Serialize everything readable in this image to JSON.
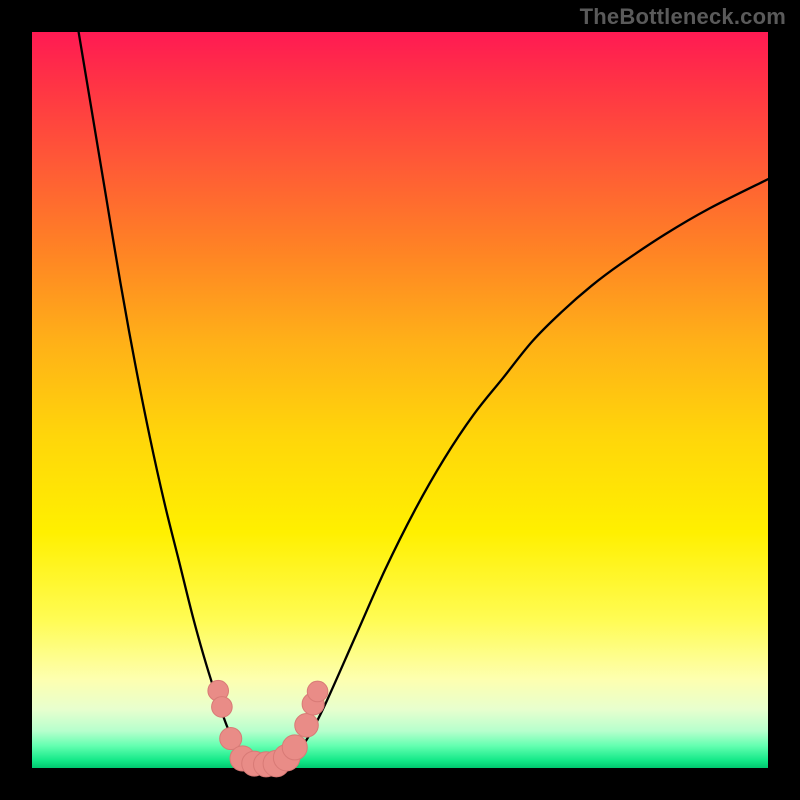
{
  "watermark": {
    "text": "TheBottleneck.com"
  },
  "colors": {
    "frame": "#000000",
    "curve": "#000000",
    "marker_fill": "#e98c87",
    "marker_stroke": "#d87a76",
    "gradient_top": "#ff1a53",
    "gradient_bottom": "#00c86f"
  },
  "chart_data": {
    "type": "line",
    "title": "",
    "xlabel": "",
    "ylabel": "",
    "xlim": [
      0,
      100
    ],
    "ylim": [
      0,
      100
    ],
    "grid": false,
    "legend": false,
    "series": [
      {
        "name": "left-branch",
        "x": [
          6,
          8,
          10,
          12,
          14,
          16,
          18,
          20,
          22,
          24,
          26,
          27,
          28,
          29,
          30
        ],
        "y": [
          102,
          90,
          78,
          66,
          55,
          45,
          36,
          28,
          20,
          13,
          7,
          4.5,
          2.5,
          1.2,
          0.5
        ]
      },
      {
        "name": "right-branch",
        "x": [
          34,
          36,
          38,
          40,
          44,
          48,
          52,
          56,
          60,
          64,
          68,
          72,
          76,
          80,
          86,
          92,
          100
        ],
        "y": [
          0.5,
          2,
          5,
          9,
          18,
          27,
          35,
          42,
          48,
          53,
          58,
          62,
          65.5,
          68.5,
          72.5,
          76,
          80
        ]
      }
    ],
    "flat_bottom": {
      "x_start": 30,
      "x_end": 34,
      "y": 0.3
    },
    "markers": {
      "name": "highlighted-points",
      "points": [
        {
          "x": 25.3,
          "y": 10.5,
          "r": 1.4
        },
        {
          "x": 25.8,
          "y": 8.3,
          "r": 1.4
        },
        {
          "x": 27.0,
          "y": 4.0,
          "r": 1.5
        },
        {
          "x": 28.6,
          "y": 1.3,
          "r": 1.7
        },
        {
          "x": 30.2,
          "y": 0.6,
          "r": 1.7
        },
        {
          "x": 31.8,
          "y": 0.5,
          "r": 1.7
        },
        {
          "x": 33.2,
          "y": 0.6,
          "r": 1.8
        },
        {
          "x": 34.6,
          "y": 1.4,
          "r": 1.8
        },
        {
          "x": 35.7,
          "y": 2.8,
          "r": 1.7
        },
        {
          "x": 37.3,
          "y": 5.8,
          "r": 1.6
        },
        {
          "x": 38.2,
          "y": 8.7,
          "r": 1.5
        },
        {
          "x": 38.8,
          "y": 10.4,
          "r": 1.4
        }
      ]
    }
  }
}
